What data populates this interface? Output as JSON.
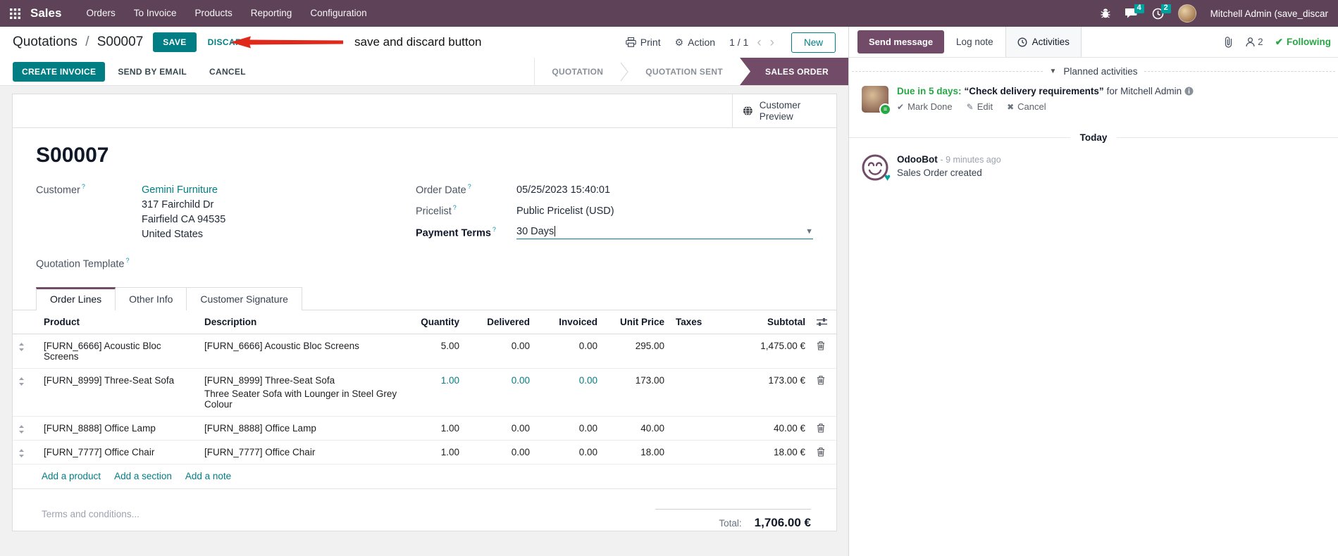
{
  "colors": {
    "brand": "#714B67",
    "navbar": "#5E4358",
    "accent": "#017E84",
    "badge": "#00A09D",
    "success": "#28a745",
    "annotation_arrow": "#E0291A"
  },
  "icons": {
    "apps": "grid-3x3",
    "bug": "bug",
    "messages": "chat-bubble",
    "activities_clock": "clock",
    "print": "printer",
    "action": "gear",
    "preview": "globe",
    "attach": "paperclip",
    "followers": "person",
    "drag": "up-down-arrows",
    "delete": "trash",
    "optional_columns": "sliders",
    "info": "info-circle"
  },
  "nav": {
    "app": "Sales",
    "menus": [
      "Orders",
      "To Invoice",
      "Products",
      "Reporting",
      "Configuration"
    ],
    "message_badge": "4",
    "activity_badge": "2",
    "user": "Mitchell Admin (save_discar"
  },
  "control": {
    "breadcrumb_parent": "Quotations",
    "breadcrumb_sep": "/",
    "breadcrumb_current": "S00007",
    "save": "SAVE",
    "discard": "DISCARD",
    "print": "Print",
    "action": "Action",
    "pager": "1 / 1",
    "new": "New"
  },
  "annotation": {
    "text": "save and discard button"
  },
  "statusbar": {
    "buttons": [
      "CREATE INVOICE",
      "SEND BY EMAIL",
      "CANCEL"
    ],
    "steps": [
      "QUOTATION",
      "QUOTATION SENT",
      "SALES ORDER"
    ],
    "active_step": "SALES ORDER"
  },
  "sheet": {
    "customer_preview": "Customer Preview",
    "title": "S00007",
    "help_marker": "?",
    "customer": {
      "label": "Customer",
      "name": "Gemini Furniture",
      "address1": "317 Fairchild Dr",
      "address2": "Fairfield CA 94535",
      "address3": "United States"
    },
    "quotation_template_label": "Quotation Template",
    "order_date": {
      "label": "Order Date",
      "value": "05/25/2023 15:40:01"
    },
    "pricelist": {
      "label": "Pricelist",
      "value": "Public Pricelist (USD)"
    },
    "payment_terms": {
      "label": "Payment Terms",
      "value": "30 Days"
    },
    "tabs": [
      "Order Lines",
      "Other Info",
      "Customer Signature"
    ],
    "active_tab": "Order Lines",
    "table": {
      "headers": {
        "product": "Product",
        "description": "Description",
        "quantity": "Quantity",
        "delivered": "Delivered",
        "invoiced": "Invoiced",
        "unit_price": "Unit Price",
        "taxes": "Taxes",
        "subtotal": "Subtotal"
      },
      "rows": [
        {
          "product": "[FURN_6666] Acoustic Bloc Screens",
          "description": "[FURN_6666] Acoustic Bloc Screens",
          "description2": "",
          "quantity": "5.00",
          "delivered": "0.00",
          "invoiced": "0.00",
          "unit_price": "295.00",
          "taxes": "",
          "subtotal": "1,475.00 €"
        },
        {
          "product": "[FURN_8999] Three-Seat Sofa",
          "description": "[FURN_8999] Three-Seat Sofa",
          "description2": "Three Seater Sofa with Lounger in Steel Grey Colour",
          "quantity": "1.00",
          "delivered": "0.00",
          "invoiced": "0.00",
          "unit_price": "173.00",
          "taxes": "",
          "subtotal": "173.00 €"
        },
        {
          "product": "[FURN_8888] Office Lamp",
          "description": "[FURN_8888] Office Lamp",
          "description2": "",
          "quantity": "1.00",
          "delivered": "0.00",
          "invoiced": "0.00",
          "unit_price": "40.00",
          "taxes": "",
          "subtotal": "40.00 €"
        },
        {
          "product": "[FURN_7777] Office Chair",
          "description": "[FURN_7777] Office Chair",
          "description2": "",
          "quantity": "1.00",
          "delivered": "0.00",
          "invoiced": "0.00",
          "unit_price": "18.00",
          "taxes": "",
          "subtotal": "18.00 €"
        }
      ],
      "links": [
        "Add a product",
        "Add a section",
        "Add a note"
      ]
    },
    "terms_placeholder": "Terms and conditions...",
    "total_label": "Total:",
    "total_value": "1,706.00 €"
  },
  "chatter": {
    "send_message": "Send message",
    "log_note": "Log note",
    "activities": "Activities",
    "follower_count": "2",
    "following": "Following",
    "planned_title": "Planned activities",
    "activity": {
      "due": "Due in 5 days:",
      "summary": "“Check delivery requirements”",
      "assignee": "for Mitchell Admin",
      "mark_done": "Mark Done",
      "edit": "Edit",
      "cancel": "Cancel"
    },
    "today": "Today",
    "message": {
      "author": "OdooBot",
      "time": "- 9 minutes ago",
      "body": "Sales Order created"
    }
  }
}
